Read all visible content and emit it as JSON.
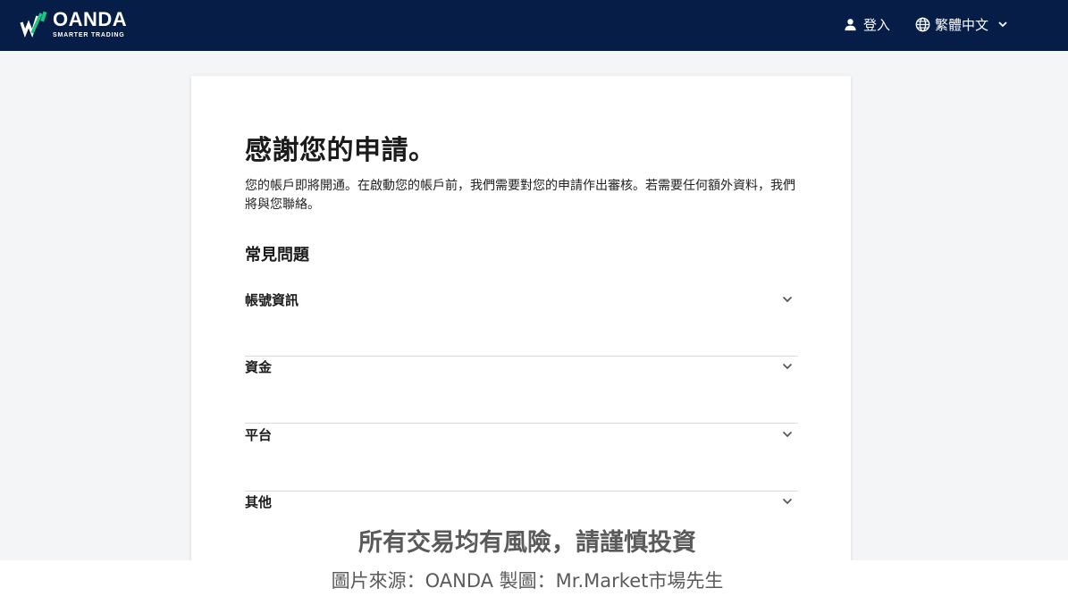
{
  "header": {
    "logo_name": "OANDA",
    "logo_tagline": "SMARTER TRADING",
    "login_label": "登入",
    "language_label": "繁體中文"
  },
  "main": {
    "title": "感謝您的申請。",
    "description": "您的帳戶即將開通。在啟動您的帳戶前，我們需要對您的申請作出審核。若需要任何額外資料，我們將與您聯絡。",
    "faq_title": "常見問題",
    "faq_items": [
      {
        "label": "帳號資訊"
      },
      {
        "label": "資金"
      },
      {
        "label": "平台"
      },
      {
        "label": "其他"
      }
    ]
  },
  "overlay": {
    "warning": "所有交易均有風險，請謹慎投資",
    "credit": "圖片來源：OANDA 製圖：Mr.Market市場先生"
  },
  "colors": {
    "topbar": "#061d48",
    "logo_accent": "#19c784",
    "background": "#f4f5f6",
    "card": "#ffffff"
  },
  "icons": [
    "oanda-logo-icon",
    "user-icon",
    "globe-icon",
    "chevron-down-icon"
  ]
}
